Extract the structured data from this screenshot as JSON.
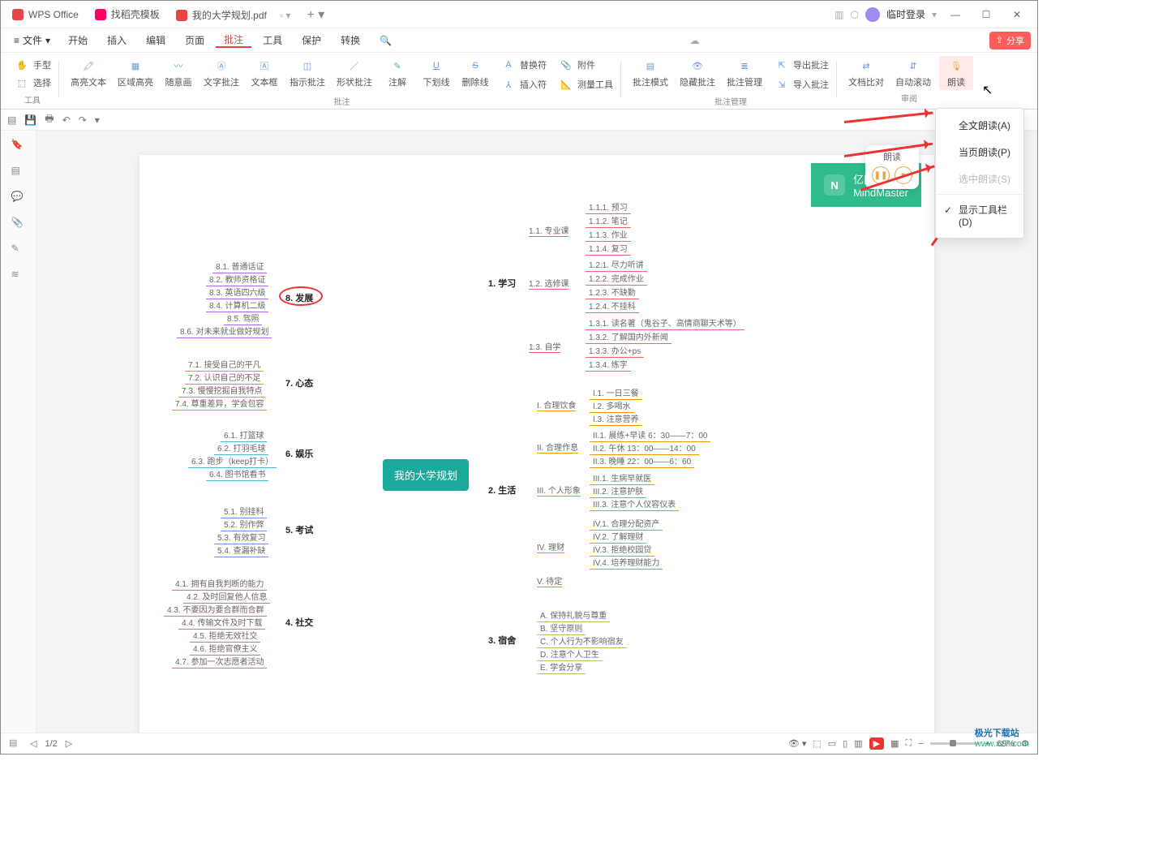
{
  "titlebar": {
    "app": "WPS Office",
    "tab_templates": "找稻壳模板",
    "tab_doc": "我的大学规划.pdf",
    "add": "+",
    "login": "临时登录"
  },
  "menubar": {
    "file": "文件",
    "items": [
      "开始",
      "插入",
      "编辑",
      "页面",
      "批注",
      "工具",
      "保护",
      "转换"
    ],
    "active": "批注",
    "share": "分享"
  },
  "ribbon": {
    "tool_hand": "手型",
    "tool_select": "选择",
    "tool_group": "工具",
    "highlight_text": "高亮文本",
    "area_highlight": "区域高亮",
    "freeform": "随意画",
    "text_annot": "文字批注",
    "textbox": "文本框",
    "squiggly": "指示批注",
    "shape": "形状批注",
    "note": "注解",
    "underline": "下划线",
    "strike": "删除线",
    "replace_sym": "替换符",
    "insert_sym": "插入符",
    "attachment": "附件",
    "measure": "测量工具",
    "annot_group": "批注",
    "annot_mode": "批注模式",
    "hide_annot": "隐藏批注",
    "manage_annot": "批注管理",
    "export_annot": "导出批注",
    "import_annot": "导入批注",
    "manage_group": "批注管理",
    "compare": "文档比对",
    "autoscroll": "自动滚动",
    "read": "朗读",
    "review_group": "审阅"
  },
  "dropdown": {
    "full": "全文朗读(A)",
    "page": "当页朗读(P)",
    "selection": "选中朗读(S)",
    "showbar": "显示工具栏(D)"
  },
  "read_controls": {
    "label": "朗读"
  },
  "mindmap": {
    "logo1": "亿图脑图",
    "logo2": "MindMaster",
    "center": "我的大学规划",
    "b1": {
      "title": "1. 学习",
      "s1": {
        "t": "1.1. 专业课",
        "leaves": [
          "1.1.1. 预习",
          "1.1.2. 笔记",
          "1.1.3. 作业",
          "1.1.4. 复习"
        ]
      },
      "s2": {
        "t": "1.2. 选修课",
        "leaves": [
          "1.2.1. 尽力听讲",
          "1.2.2. 完成作业",
          "1.2.3. 不缺勤",
          "1.2.4. 不挂科"
        ]
      },
      "s3": {
        "t": "1.3. 自学",
        "leaves": [
          "1.3.1. 读名著（鬼谷子、高情商聊天术等）",
          "1.3.2. 了解国内外新闻",
          "1.3.3. 办公+ps",
          "1.3.4. 练字"
        ]
      }
    },
    "b2": {
      "title": "2. 生活",
      "s1": {
        "t": "I. 合理饮食",
        "leaves": [
          "I.1. 一日三餐",
          "I.2. 多喝水",
          "I.3. 注意营养"
        ]
      },
      "s2": {
        "t": "II. 合理作息",
        "leaves": [
          "II.1. 晨练+早读 6：30——7：00",
          "II.2. 午休 13：00——14：00",
          "II.3. 晚睡 22：00——6：60"
        ]
      },
      "s3": {
        "t": "III. 个人形象",
        "leaves": [
          "III.1. 生病早就医",
          "III.2. 注意护肤",
          "III.3. 注意个人仪容仪表"
        ]
      },
      "s4": {
        "t": "IV. 理财",
        "leaves": [
          "IV.1. 合理分配资产",
          "IV.2. 了解理财",
          "IV.3. 拒绝校园贷",
          "IV.4. 培养理财能力"
        ]
      },
      "s5": {
        "t": "V. 待定",
        "leaves": []
      }
    },
    "b3": {
      "title": "3. 宿舍",
      "leaves": [
        "A. 保持礼貌与尊重",
        "B. 坚守原则",
        "C. 个人行为不影响宿友",
        "D. 注意个人卫生",
        "E. 学会分享"
      ]
    },
    "b4": {
      "title": "4. 社交",
      "leaves": [
        "4.1. 拥有自我判断的能力",
        "4.2. 及时回复他人信息",
        "4.3. 不要因为要合群而合群",
        "4.4. 传输文件及时下载",
        "4.5. 拒绝无效社交",
        "4.6. 拒绝官僚主义",
        "4.7. 参加一次志愿者活动"
      ]
    },
    "b5": {
      "title": "5. 考试",
      "leaves": [
        "5.1. 别挂科",
        "5.2. 别作弊",
        "5.3. 有效复习",
        "5.4. 查漏补缺"
      ]
    },
    "b6": {
      "title": "6. 娱乐",
      "leaves": [
        "6.1. 打篮球",
        "6.2. 打羽毛球",
        "6.3. 跑步（keep打卡）",
        "6.4. 图书馆看书"
      ]
    },
    "b7": {
      "title": "7. 心态",
      "leaves": [
        "7.1. 接受自己的平凡",
        "7.2. 认识自己的不足",
        "7.3. 慢慢挖掘自我特点",
        "7.4. 尊重差异，学会包容"
      ]
    },
    "b8": {
      "title": "8. 发展",
      "leaves": [
        "8.1. 普通话证",
        "8.2. 教师资格证",
        "8.3. 英语四六级",
        "8.4. 计算机二级",
        "8.5. 驾照",
        "8.6. 对未来就业做好规划"
      ]
    }
  },
  "statusbar": {
    "page": "1/2",
    "zoom": "69%"
  },
  "watermark": {
    "brand": "极光下载站",
    "site": "www.xz7.com"
  }
}
